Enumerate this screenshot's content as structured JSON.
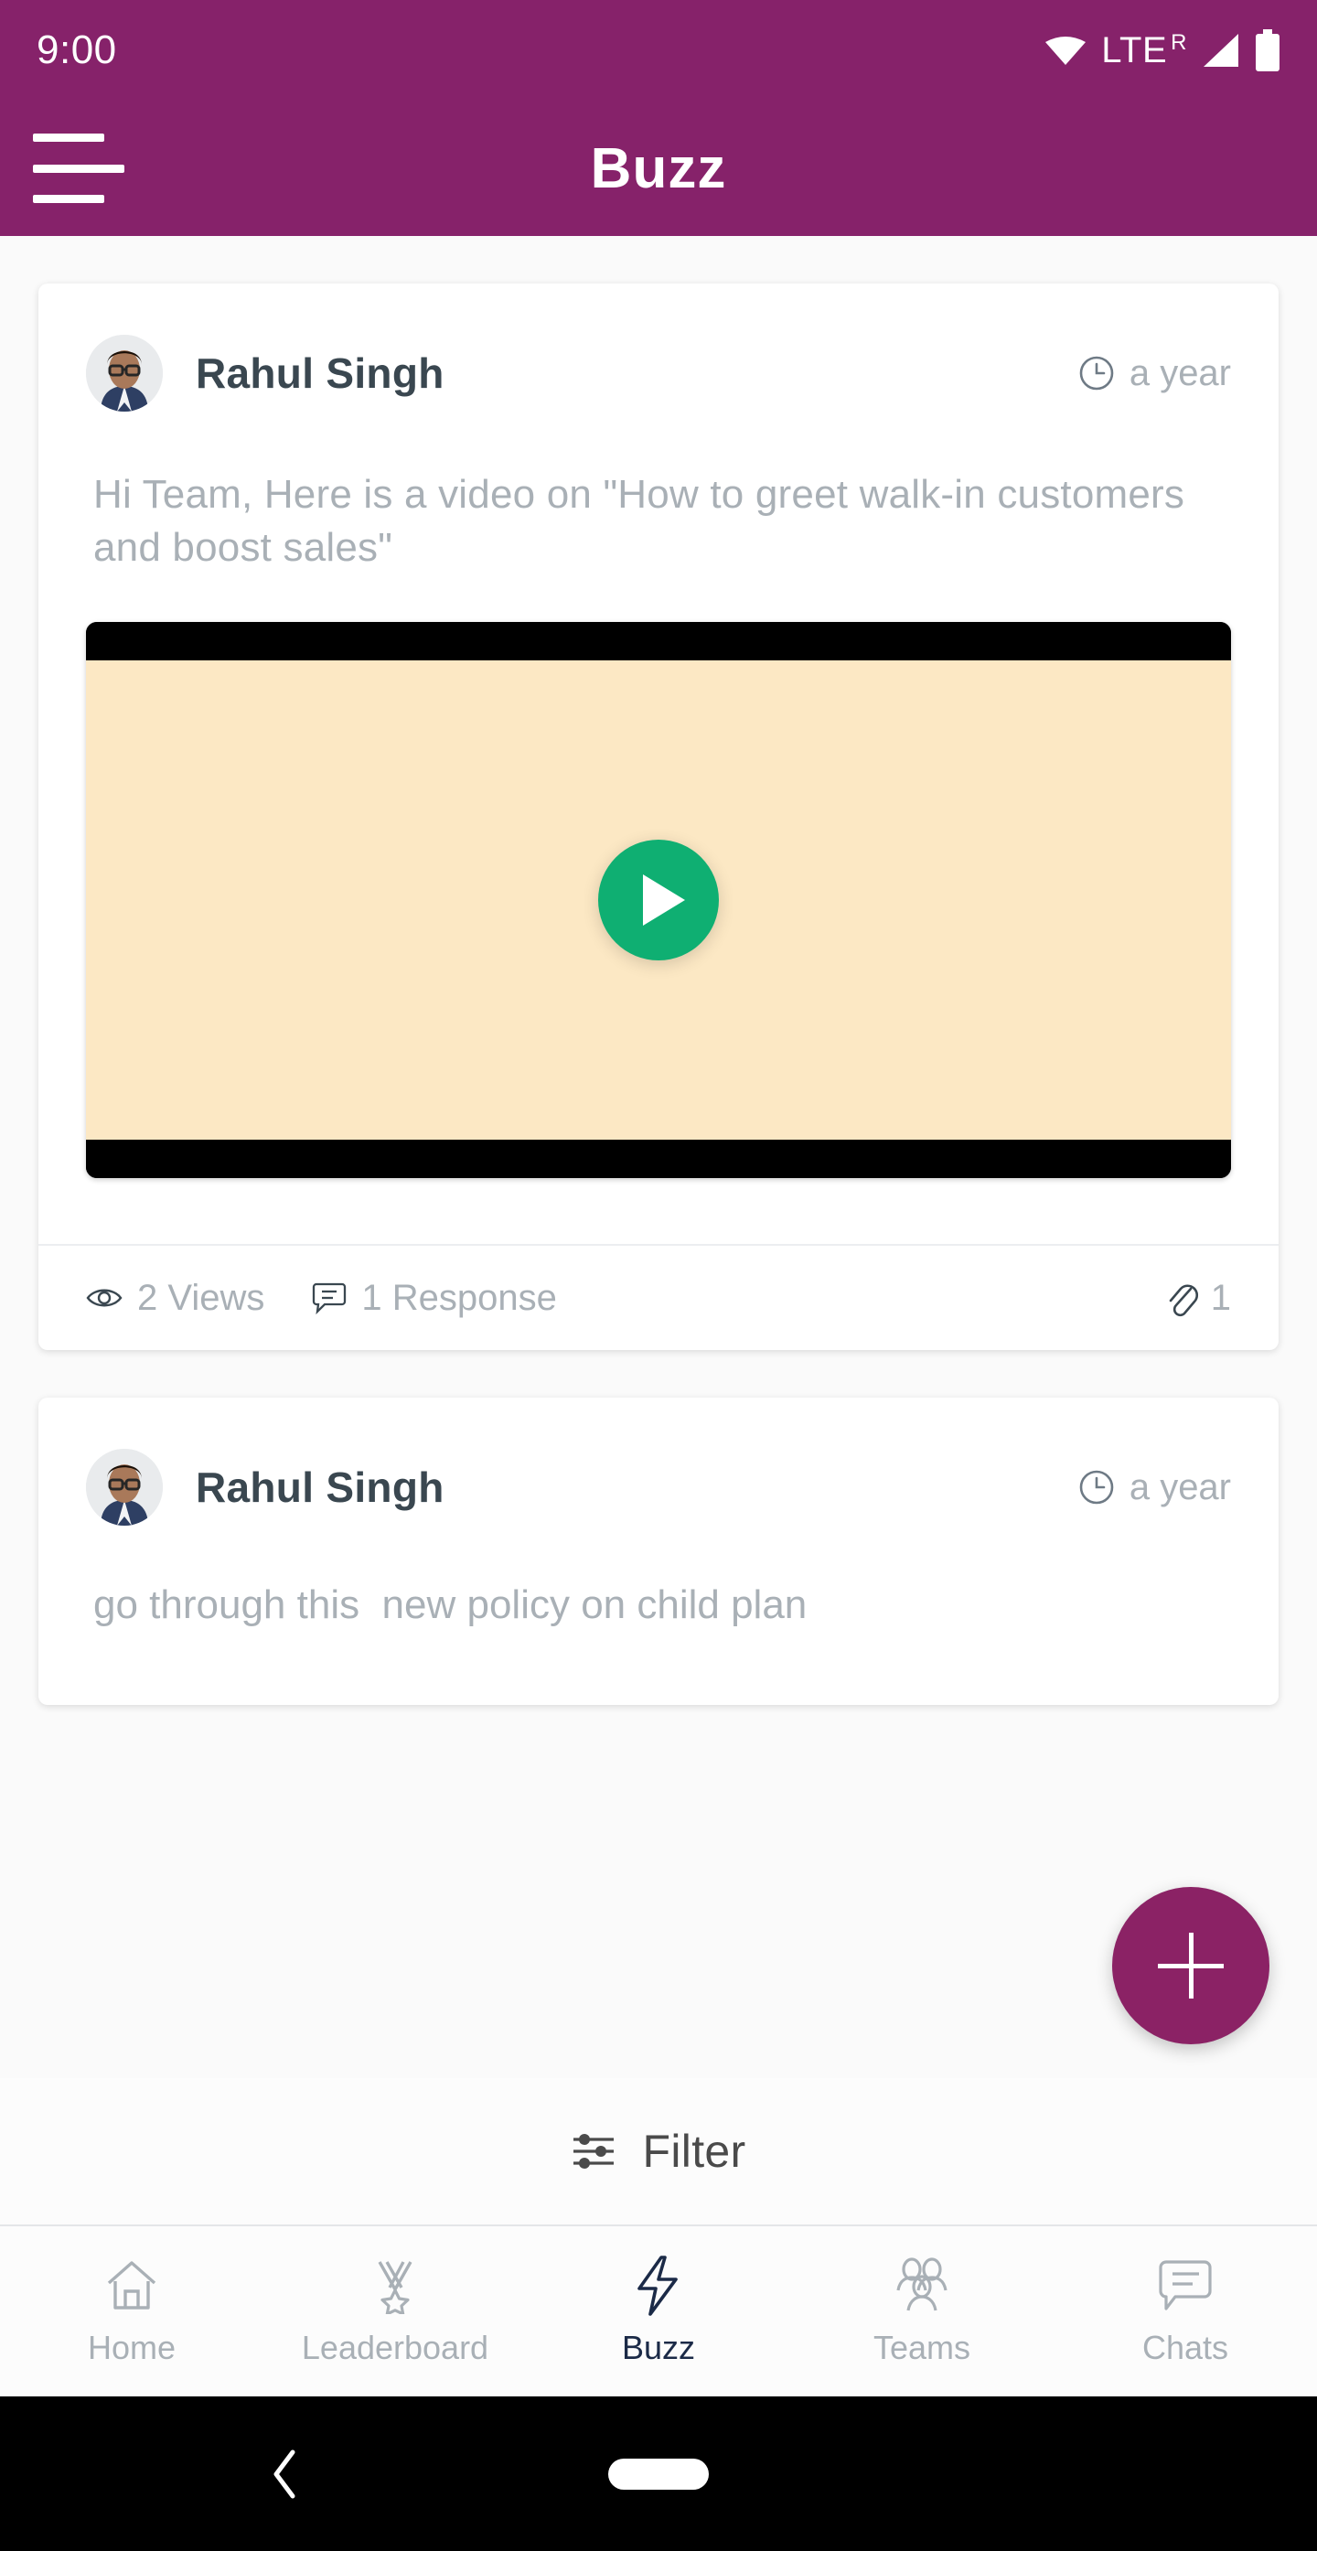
{
  "status_bar": {
    "time": "9:00",
    "network_label": "LTE",
    "network_superscript": "R",
    "icons": [
      "wifi-icon",
      "signal-icon",
      "battery-icon"
    ]
  },
  "app_bar": {
    "title": "Buzz",
    "menu_icon": "hamburger-menu-icon",
    "background_color": "#86226A"
  },
  "theme": {
    "primary": "#86226A",
    "fab": "#8B2265",
    "accent_play": "#0FAF72",
    "active_nav": "#1B2A47",
    "muted_text": "#A9B0B6"
  },
  "posts": [
    {
      "author": "Rahul Singh",
      "time": "a year",
      "time_icon": "clock-icon",
      "text": "Hi Team, Here is a video on \"How to greet walk-in customers and boost sales\"",
      "media": {
        "type": "video",
        "play_icon": "play-icon",
        "background_color": "#FCE8C4"
      },
      "views_icon": "eye-icon",
      "views": "2 Views",
      "responses_icon": "comment-bubble-icon",
      "responses": "1 Response",
      "attachment_icon": "paperclip-icon",
      "attachment_count": "1"
    },
    {
      "author": "Rahul Singh",
      "time": "a year",
      "time_icon": "clock-icon",
      "text": "go through this  new policy on child plan"
    }
  ],
  "fab": {
    "icon": "plus-icon",
    "label": "create-post"
  },
  "filter": {
    "label": "Filter",
    "icon": "sliders-filter-icon"
  },
  "bottom_nav": {
    "items": [
      {
        "label": "Home",
        "icon": "home-icon",
        "active": false
      },
      {
        "label": "Leaderboard",
        "icon": "medal-icon",
        "active": false
      },
      {
        "label": "Buzz",
        "icon": "lightning-icon",
        "active": true
      },
      {
        "label": "Teams",
        "icon": "people-group-icon",
        "active": false
      },
      {
        "label": "Chats",
        "icon": "chat-icon",
        "active": false
      }
    ]
  },
  "system_nav": {
    "back_icon": "back-chevron-icon",
    "home_icon": "home-pill-icon"
  }
}
